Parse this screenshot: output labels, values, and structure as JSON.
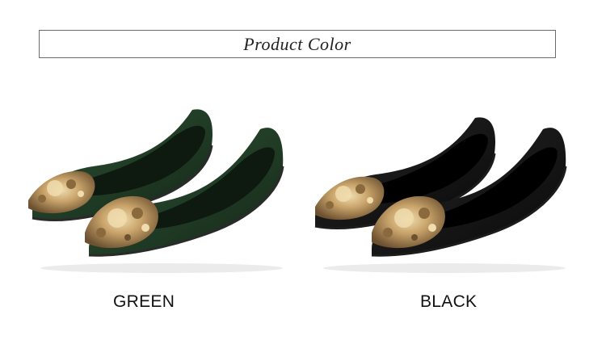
{
  "header": {
    "title": "Product Color"
  },
  "colors": {
    "green": {
      "label": "GREEN",
      "shoe_color": "#1f3a24",
      "shoe_shade": "#142a18",
      "lining": "#0e1a10",
      "sole": "#2a2a2a"
    },
    "black": {
      "label": "BLACK",
      "shoe_color": "#151515",
      "shoe_shade": "#0a0a0a",
      "lining": "#000000",
      "sole": "#1c1c1c"
    },
    "jewel_gold": "#c8a36a",
    "jewel_amber": "#8a6a3c",
    "jewel_highlight": "#f0dcae"
  }
}
